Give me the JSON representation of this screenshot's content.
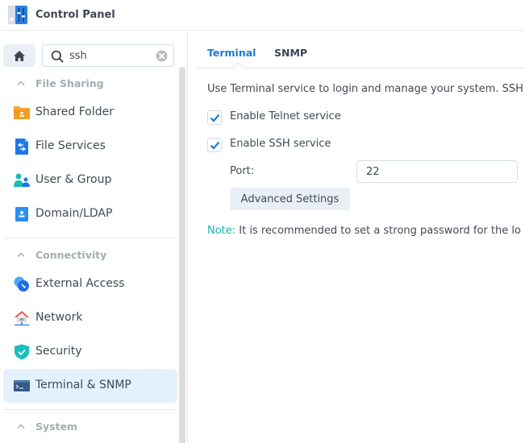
{
  "window": {
    "title": "Control Panel",
    "app_icon": "control-panel-icon"
  },
  "sidebar": {
    "home_icon": "home-icon",
    "search": {
      "value": "ssh",
      "placeholder": "Search",
      "icon": "search-icon",
      "clear_icon": "clear-icon"
    },
    "groups": [
      {
        "label": "File Sharing",
        "expanded": true,
        "items": [
          {
            "label": "Shared Folder",
            "icon": "shared-folder-icon"
          },
          {
            "label": "File Services",
            "icon": "file-services-icon"
          },
          {
            "label": "User & Group",
            "icon": "user-group-icon"
          },
          {
            "label": "Domain/LDAP",
            "icon": "domain-ldap-icon"
          }
        ]
      },
      {
        "label": "Connectivity",
        "expanded": true,
        "items": [
          {
            "label": "External Access",
            "icon": "external-access-icon"
          },
          {
            "label": "Network",
            "icon": "network-icon"
          },
          {
            "label": "Security",
            "icon": "security-shield-icon"
          },
          {
            "label": "Terminal & SNMP",
            "icon": "terminal-icon",
            "active": true
          }
        ]
      },
      {
        "label": "System",
        "expanded": true,
        "items": []
      }
    ]
  },
  "main": {
    "tabs": [
      {
        "label": "Terminal",
        "active": true
      },
      {
        "label": "SNMP",
        "active": false
      }
    ],
    "description": "Use Terminal service to login and manage your system. SSH",
    "options": [
      {
        "label": "Enable Telnet service",
        "checked": true
      },
      {
        "label": "Enable SSH service",
        "checked": true
      }
    ],
    "port": {
      "label": "Port:",
      "value": "22"
    },
    "advanced_button": "Advanced Settings",
    "note": {
      "prefix": "Note:",
      "text": " It is recommended to set a strong password for the lo"
    }
  },
  "colors": {
    "accent": "#1b7ad3",
    "active_item_bg": "#e4f0fc",
    "note_prefix": "#19b3b7",
    "group_label": "#a4acb6",
    "button_bg": "#eaeff5"
  }
}
